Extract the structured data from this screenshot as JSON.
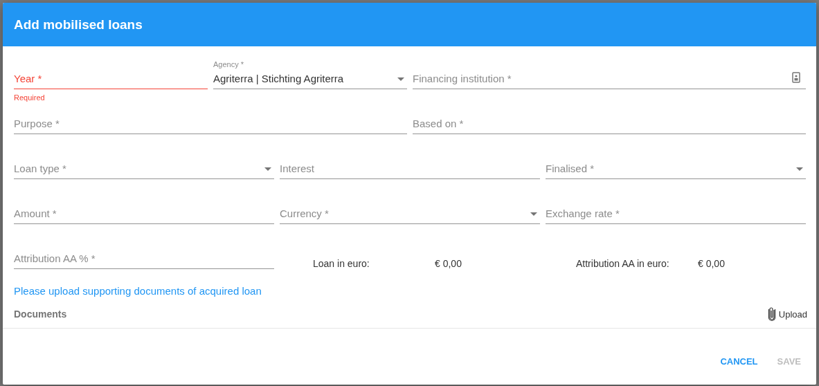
{
  "dialog": {
    "title": "Add mobilised loans"
  },
  "field_rows": [
    [
      {
        "kind": "text",
        "label": "Year *",
        "error": true,
        "helper": "Required"
      },
      {
        "kind": "select",
        "label": "Agency *",
        "value": "Agriterra | Stichting Agriterra",
        "error": false
      },
      {
        "kind": "lookup",
        "label": "Financing institution *",
        "error": false
      }
    ],
    [
      {
        "kind": "text",
        "label": "Purpose *",
        "error": false
      },
      {
        "kind": "text",
        "label": "Based on *",
        "error": false
      }
    ],
    [
      {
        "kind": "select",
        "label": "Loan type *",
        "error": false
      },
      {
        "kind": "text",
        "label": "Interest",
        "error": false
      },
      {
        "kind": "select",
        "label": "Finalised *",
        "error": false
      }
    ],
    [
      {
        "kind": "text",
        "label": "Amount *",
        "error": false
      },
      {
        "kind": "select",
        "label": "Currency *",
        "error": false
      },
      {
        "kind": "text",
        "label": "Exchange rate *",
        "error": false
      }
    ]
  ],
  "attribution_field": {
    "kind": "text",
    "label": "Attribution AA % *",
    "error": false
  },
  "totals": [
    {
      "label": "Loan in euro:",
      "value": "€ 0,00"
    },
    {
      "label": "Attribution AA in euro:",
      "value": "€ 0,00"
    }
  ],
  "upload_notice": "Please upload supporting documents of acquired loan",
  "documents": {
    "heading": "Documents",
    "upload_button": "Upload"
  },
  "buttons": [
    {
      "label": "CANCEL",
      "disabled": false
    },
    {
      "label": "SAVE",
      "disabled": true
    }
  ]
}
